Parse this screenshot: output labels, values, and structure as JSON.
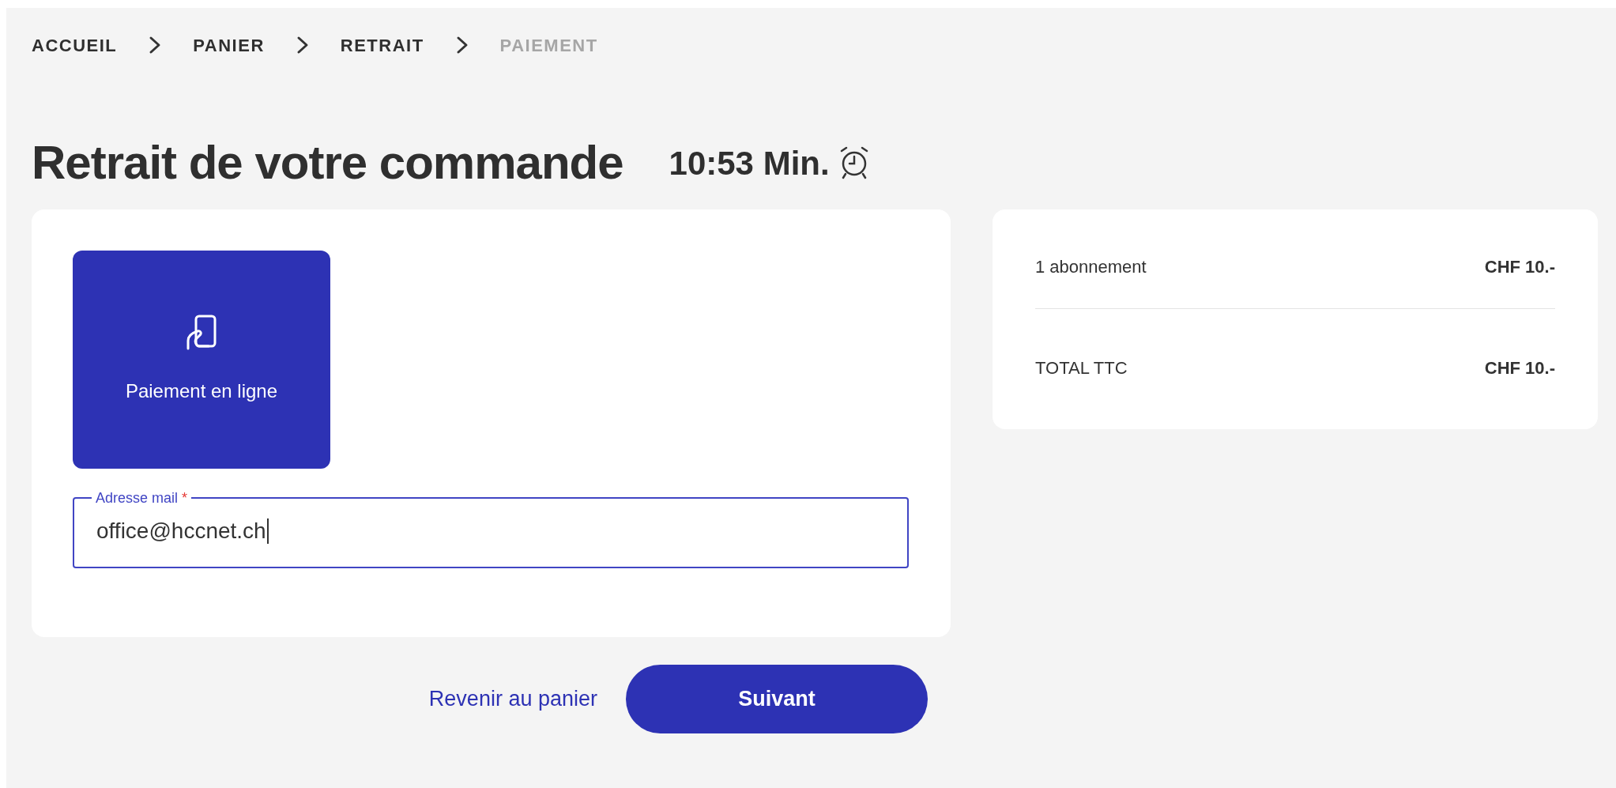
{
  "breadcrumb": [
    {
      "label": "ACCUEIL",
      "disabled": false
    },
    {
      "label": "PANIER",
      "disabled": false
    },
    {
      "label": "RETRAIT",
      "disabled": false
    },
    {
      "label": "PAIEMENT",
      "disabled": true
    }
  ],
  "title": "Retrait de votre commande",
  "timer": "10:53 Min.",
  "payment_methods": [
    {
      "label": "Paiement en ligne",
      "selected": true
    }
  ],
  "email_field": {
    "label": "Adresse mail",
    "required": true,
    "required_mark": "*",
    "value": "office@hccnet.ch",
    "focused": true
  },
  "summary": {
    "rows": [
      {
        "label": "1 abonnement",
        "amount": "CHF 10.-"
      },
      {
        "label": "TOTAL TTC",
        "amount": "CHF 10.-"
      }
    ]
  },
  "actions": {
    "back_link": "Revenir au panier",
    "next_button": "Suivant"
  }
}
